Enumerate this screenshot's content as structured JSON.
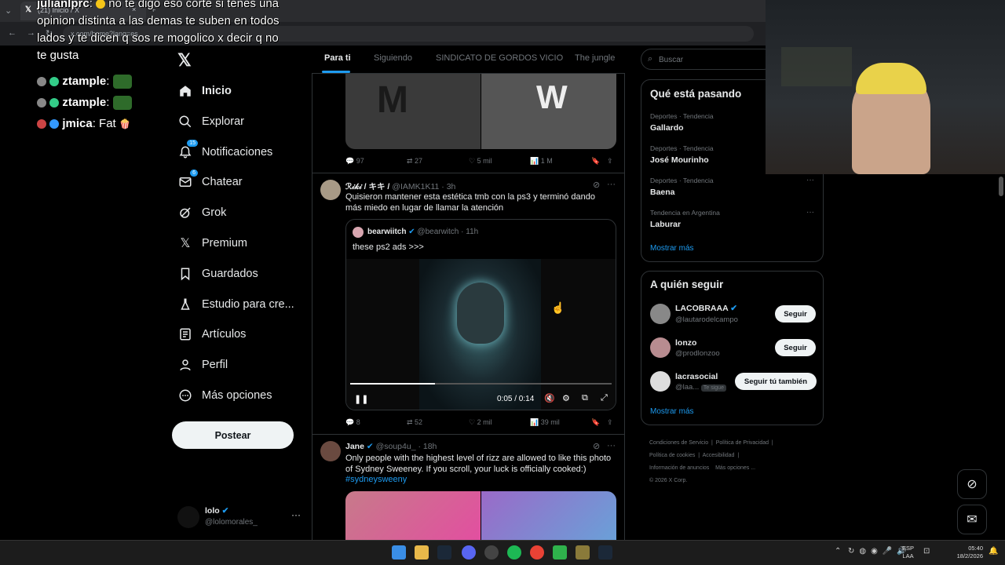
{
  "browser": {
    "tab_title": "(21) Inicio / X",
    "url": "x.com/home?lang=es"
  },
  "chat": {
    "messages": [
      {
        "user": "julianlprc",
        "text": "no te digo eso corte si tenes una opinion distinta a las demas te suben en todos lados y te dicen q sos re mogolico x decir q no te gusta"
      },
      {
        "user": "ztample",
        "text": ""
      },
      {
        "user": "ztample",
        "text": ""
      },
      {
        "user": "jmica",
        "text": "Fat"
      }
    ]
  },
  "nav": {
    "items": [
      {
        "label": "Inicio",
        "icon": "home-icon"
      },
      {
        "label": "Explorar",
        "icon": "search-icon"
      },
      {
        "label": "Notificaciones",
        "icon": "bell-icon",
        "badge": "15"
      },
      {
        "label": "Chatear",
        "icon": "mail-icon",
        "badge": "6"
      },
      {
        "label": "Grok",
        "icon": "grok-icon"
      },
      {
        "label": "Premium",
        "icon": "x-logo-icon"
      },
      {
        "label": "Guardados",
        "icon": "bookmark-icon"
      },
      {
        "label": "Estudio para cre...",
        "icon": "flask-icon"
      },
      {
        "label": "Artículos",
        "icon": "article-icon"
      },
      {
        "label": "Perfil",
        "icon": "person-icon"
      },
      {
        "label": "Más opciones",
        "icon": "more-circle-icon"
      }
    ],
    "post_button": "Postear",
    "account": {
      "name": "lolo",
      "handle": "@lolomorales_"
    }
  },
  "timeline": {
    "tabs": [
      "Para ti",
      "Siguiendo",
      "SINDICATO DE GORDOS VICIO",
      "The jungle"
    ],
    "tweet0": {
      "replies": "97",
      "retweets": "27",
      "likes": "5 mil",
      "views": "1 M"
    },
    "tweet1": {
      "name": "ℛ𝒾𝓀𝒾 / キキ /",
      "handle": "@IAMK1K11",
      "time": "· 3h",
      "text": "Quisieron mantener esta estética tmb con la ps3 y terminó dando más miedo en lugar de llamar la atención",
      "quote": {
        "name": "bearwiitch",
        "handle": "@bearwitch",
        "time": "· 11h",
        "text": "these ps2 ads >>>"
      },
      "video_time": "0:05 / 0:14",
      "replies": "8",
      "retweets": "52",
      "likes": "2 mil",
      "views": "39 mil"
    },
    "tweet2": {
      "name": "Jane",
      "handle": "@soup4u_",
      "time": "· 18h",
      "text": "Only people with the highest level of rizz are allowed to like this photo of Sydney Sweeney. If you scroll, your luck is officially cooked:)",
      "hashtag": "#sydneysweeny"
    }
  },
  "right": {
    "search_placeholder": "Buscar",
    "trends_title": "Qué está pasando",
    "trends": [
      {
        "sub": "Deportes · Tendencia",
        "name": "Gallardo"
      },
      {
        "sub": "Deportes · Tendencia",
        "name": "José Mourinho"
      },
      {
        "sub": "Deportes · Tendencia",
        "name": "Baena"
      },
      {
        "sub": "Tendencia en Argentina",
        "name": "Laburar"
      }
    ],
    "show_more": "Mostrar más",
    "follow_title": "A quién seguir",
    "follow": [
      {
        "name": "LACOBRAAA",
        "handle": "@lautarodelcampo",
        "button": "Seguir"
      },
      {
        "name": "lonzo",
        "handle": "@prodlonzoo",
        "button": "Seguir"
      },
      {
        "name": "lacrasocial",
        "handle": "@laa...",
        "tag": "Te sigue",
        "button": "Seguir tú también"
      }
    ],
    "footer": [
      "Condiciones de Servicio",
      "Política de Privacidad",
      "Política de cookies",
      "Accesibilidad",
      "Información de anuncios",
      "Más opciones ...",
      "© 2026 X Corp."
    ]
  },
  "taskbar": {
    "lang": "ESP",
    "lang2": "LAA",
    "time": "05:40",
    "date": "18/2/2026"
  }
}
